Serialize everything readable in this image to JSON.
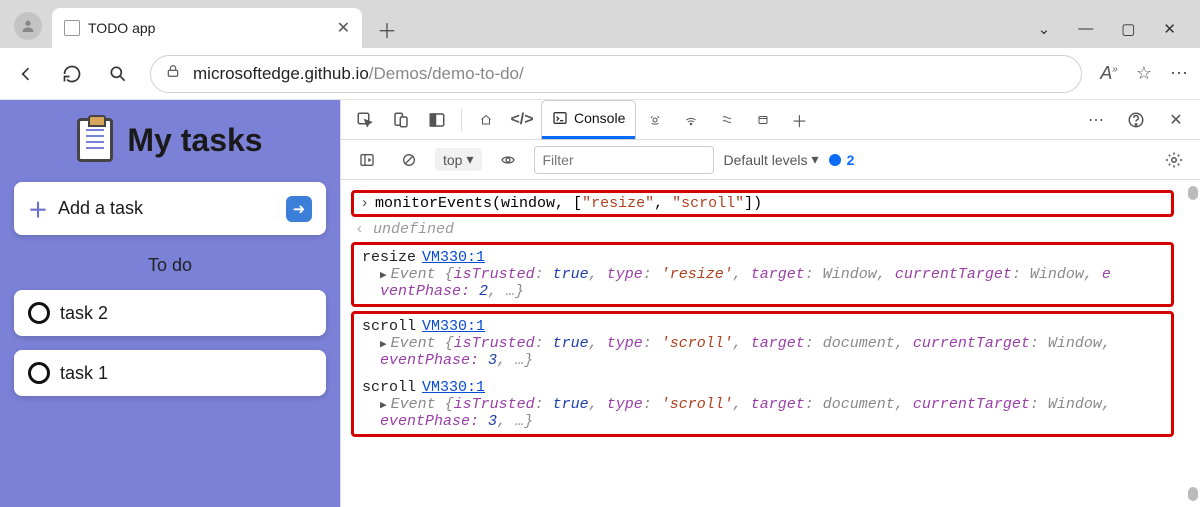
{
  "browser": {
    "tab_title": "TODO app",
    "url_host": "microsoftedge.github.io",
    "url_path": "/Demos/demo-to-do/"
  },
  "app": {
    "title": "My tasks",
    "add_task_label": "Add a task",
    "section_title": "To do",
    "tasks": [
      "task 2",
      "task 1"
    ]
  },
  "devtools": {
    "console_tab": "Console",
    "context": "top",
    "filter_placeholder": "Filter",
    "levels_label": "Default levels",
    "issues_count": "2",
    "input_line": "monitorEvents(window, [\"resize\", \"scroll\"])",
    "return_value": "undefined",
    "vm_source": "VM330:1",
    "events": [
      {
        "name": "resize",
        "detail_prefix": "Event {",
        "isTrusted": "true",
        "type": "'resize'",
        "target": "Window",
        "currentTarget": "Window",
        "tail": "e",
        "line2_prefix": "ventPhase:",
        "line2_val": "2",
        "line2_suffix": ", …}"
      },
      {
        "name": "scroll",
        "detail_prefix": "Event {",
        "isTrusted": "true",
        "type": "'scroll'",
        "target": "document",
        "currentTarget": "Window",
        "tail": "",
        "line2_prefix": "eventPhase:",
        "line2_val": "3",
        "line2_suffix": ", …}"
      },
      {
        "name": "scroll",
        "detail_prefix": "Event {",
        "isTrusted": "true",
        "type": "'scroll'",
        "target": "document",
        "currentTarget": "Window",
        "tail": "",
        "line2_prefix": "eventPhase:",
        "line2_val": "3",
        "line2_suffix": ", …}"
      }
    ]
  }
}
